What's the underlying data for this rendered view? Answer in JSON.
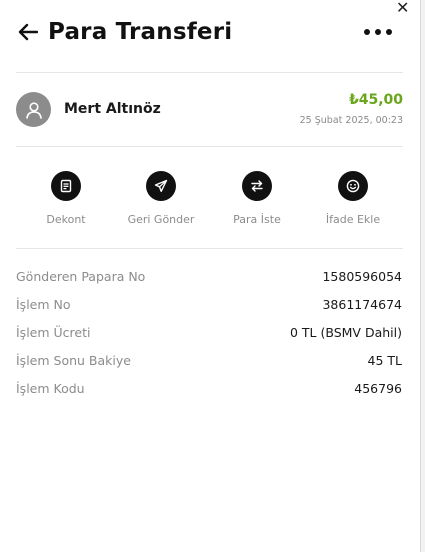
{
  "window": {
    "close_symbol": "✕"
  },
  "header": {
    "title": "Para Transferi",
    "back_icon": "arrow-left-icon",
    "more_icon": "more-horizontal-icon"
  },
  "transaction": {
    "name": "Mert Altınöz",
    "amount": "₺45,00",
    "date": "25 Şubat 2025, 00:23",
    "avatar_icon": "user-icon",
    "amount_color": "#6aa51c"
  },
  "actions": [
    {
      "label": "Dekont",
      "icon": "receipt-icon"
    },
    {
      "label": "Geri Gönder",
      "icon": "send-icon"
    },
    {
      "label": "Para İste",
      "icon": "swap-arrows-icon"
    },
    {
      "label": "İfade Ekle",
      "icon": "smiley-icon"
    }
  ],
  "details": [
    {
      "label": "Gönderen Papara No",
      "value": "1580596054"
    },
    {
      "label": "İşlem No",
      "value": "3861174674"
    },
    {
      "label": "İşlem Ücreti",
      "value": "0 TL (BSMV Dahil)"
    },
    {
      "label": "İşlem Sonu Bakiye",
      "value": "45 TL"
    },
    {
      "label": "İşlem Kodu",
      "value": "456796"
    }
  ]
}
